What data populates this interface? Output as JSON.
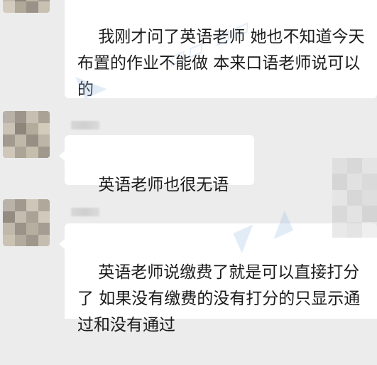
{
  "chat": {
    "messages": [
      {
        "text": "我刚才问了英语老师 她也不知道今天布置的作业不能做 本来口语老师说可以的"
      },
      {
        "text": "英语老师也很无语"
      },
      {
        "text": "英语老师说缴费了就是可以直接打分了 如果没有缴费的没有打分的只显示通过和没有通过"
      }
    ]
  },
  "colors": {
    "background": "#ececec",
    "bubble": "#ffffff",
    "text": "#1b1b1b"
  },
  "icons": {
    "avatar": "pixelated-avatar-icon"
  }
}
